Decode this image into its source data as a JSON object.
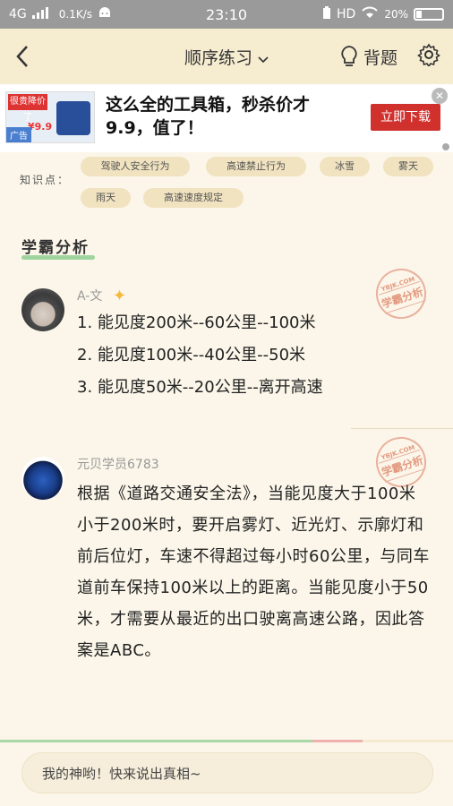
{
  "status": {
    "network": "4G",
    "speed": "0.1K/s",
    "time": "23:10",
    "hd": "HD",
    "battery_label": "20%",
    "battery_level": 0.2
  },
  "header": {
    "title": "顺序练习",
    "recite_label": "背题"
  },
  "ad": {
    "image_tag": "很贵降价了",
    "image_price": "¥9.9",
    "image_ad_label": "广告",
    "text": "这么全的工具箱，秒杀价才9.9，值了！",
    "cta": "立即下载",
    "close": "✕"
  },
  "knowledge": {
    "label": "知识点：",
    "tags": [
      "驾驶人安全行为",
      "高速禁止行为",
      "冰雪",
      "雾天",
      "雨天",
      "高速速度规定"
    ]
  },
  "analysis": {
    "section_title": "学霸分析",
    "stamp_text": "学霸分析",
    "stamp_small": "YBJK.COM",
    "comments": [
      {
        "author": "A-文",
        "lines": [
          "1. 能见度200米--60公里--100米",
          "2. 能见度100米--40公里--50米",
          "3. 能见度50米--20公里--离开高速"
        ]
      },
      {
        "author": "元贝学员6783",
        "text": "根据《道路交通安全法》，当能见度大于100米小于200米时，要开启雾灯、近光灯、示廓灯和前后位灯，车速不得超过每小时60公里，与同车道前车保持100米以上的距离。当能见度小于50米，才需要从最近的出口驶离高速公路，因此答案是ABC。"
      }
    ]
  },
  "progress": {
    "correct_fraction": 0.69,
    "wrong_fraction": 0.11
  },
  "comment_input": {
    "placeholder": "我的神哟！快来说出真相~"
  },
  "colors": {
    "background": "#fbf6e9",
    "header": "#f6ecd0",
    "accent_green": "#9fd49f",
    "ad_button": "#d0312d",
    "stamp": "#e08a6e"
  }
}
